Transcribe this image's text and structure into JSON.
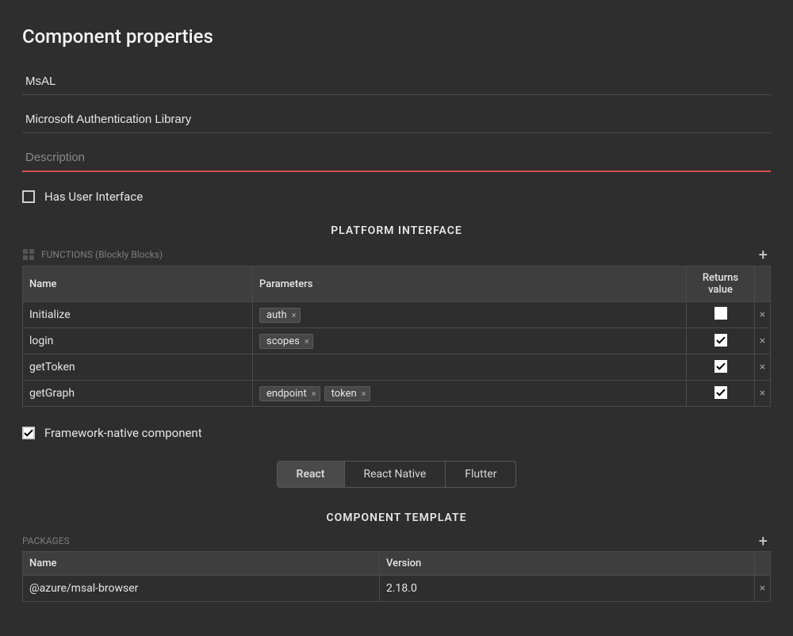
{
  "title": "Component properties",
  "fields": {
    "name": "MsAL",
    "caption": "Microsoft Authentication Library",
    "description_placeholder": "Description",
    "description": ""
  },
  "has_ui": {
    "label": "Has User Interface",
    "checked": false
  },
  "platform_interface": {
    "heading": "PLATFORM INTERFACE",
    "functions_label": "FUNCTIONS (Blockly Blocks)",
    "columns": {
      "name": "Name",
      "parameters": "Parameters",
      "returns": "Returns value"
    },
    "rows": [
      {
        "name": "Initialize",
        "params": [
          "auth"
        ],
        "returns": false
      },
      {
        "name": "login",
        "params": [
          "scopes"
        ],
        "returns": true
      },
      {
        "name": "getToken",
        "params": [],
        "returns": true
      },
      {
        "name": "getGraph",
        "params": [
          "endpoint",
          "token"
        ],
        "returns": true
      }
    ]
  },
  "framework_native": {
    "label": "Framework-native component",
    "checked": true
  },
  "frameworks": {
    "options": [
      "React",
      "React Native",
      "Flutter"
    ],
    "selected": "React"
  },
  "component_template": {
    "heading": "COMPONENT TEMPLATE",
    "packages_label": "PACKAGES",
    "columns": {
      "name": "Name",
      "version": "Version"
    },
    "rows": [
      {
        "name": "@azure/msal-browser",
        "version": "2.18.0"
      }
    ]
  }
}
